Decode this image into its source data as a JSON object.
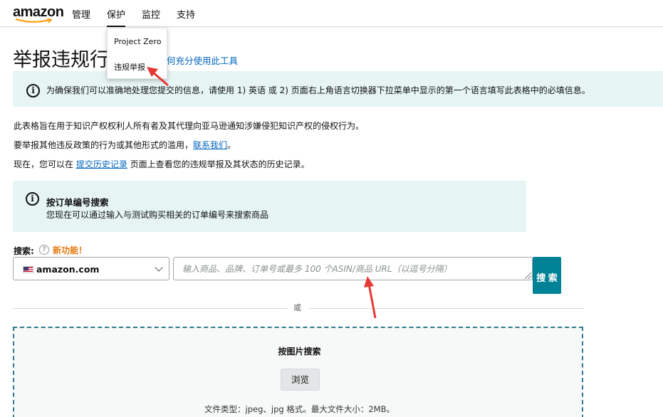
{
  "nav": {
    "logo": "amazon",
    "items": [
      "管理",
      "保护",
      "监控",
      "支持"
    ],
    "active_index": 1
  },
  "dropdown": {
    "items": [
      "Project Zero",
      "违规举报"
    ]
  },
  "page": {
    "title": "举报违规行",
    "help_link": "何充分使用此工具"
  },
  "info_banner": {
    "text": "为确保我们可以准确地处理您提交的信息，请使用 1) 英语 或 2) 页面右上角语言切换器下拉菜单中显示的第一个语言填写此表格中的必填信息。"
  },
  "intro": {
    "line1": "此表格旨在用于知识产权权利人所有者及其代理向亚马逊通知涉嫌侵犯知识产权的侵权行为。",
    "line2_prefix": "要举报其他违反政策的行为或其他形式的滥用，",
    "line2_link": "联系我们",
    "line2_suffix": "。",
    "line3_prefix": "现在，您可以在 ",
    "line3_link": "提交历史记录",
    "line3_suffix": " 页面上查看您的违规举报及其状态的历史记录。"
  },
  "order_search": {
    "title": "按订单编号搜索",
    "description": "您现在可以通过输入与测试购买相关的订单编号来搜索商品"
  },
  "search": {
    "label": "搜索:",
    "help": "?",
    "new_feature": "新功能！",
    "marketplace": "amazon.com",
    "placeholder": "输入商品、品牌、订单号或最多 100 个ASIN/商品 URL（以逗号分隔）",
    "button": "搜 索",
    "or": "或"
  },
  "image_search": {
    "title": "按图片搜索",
    "browse": "浏览",
    "file_type": "文件类型：jpeg、jpg 格式。最大文件大小：2MB。"
  }
}
